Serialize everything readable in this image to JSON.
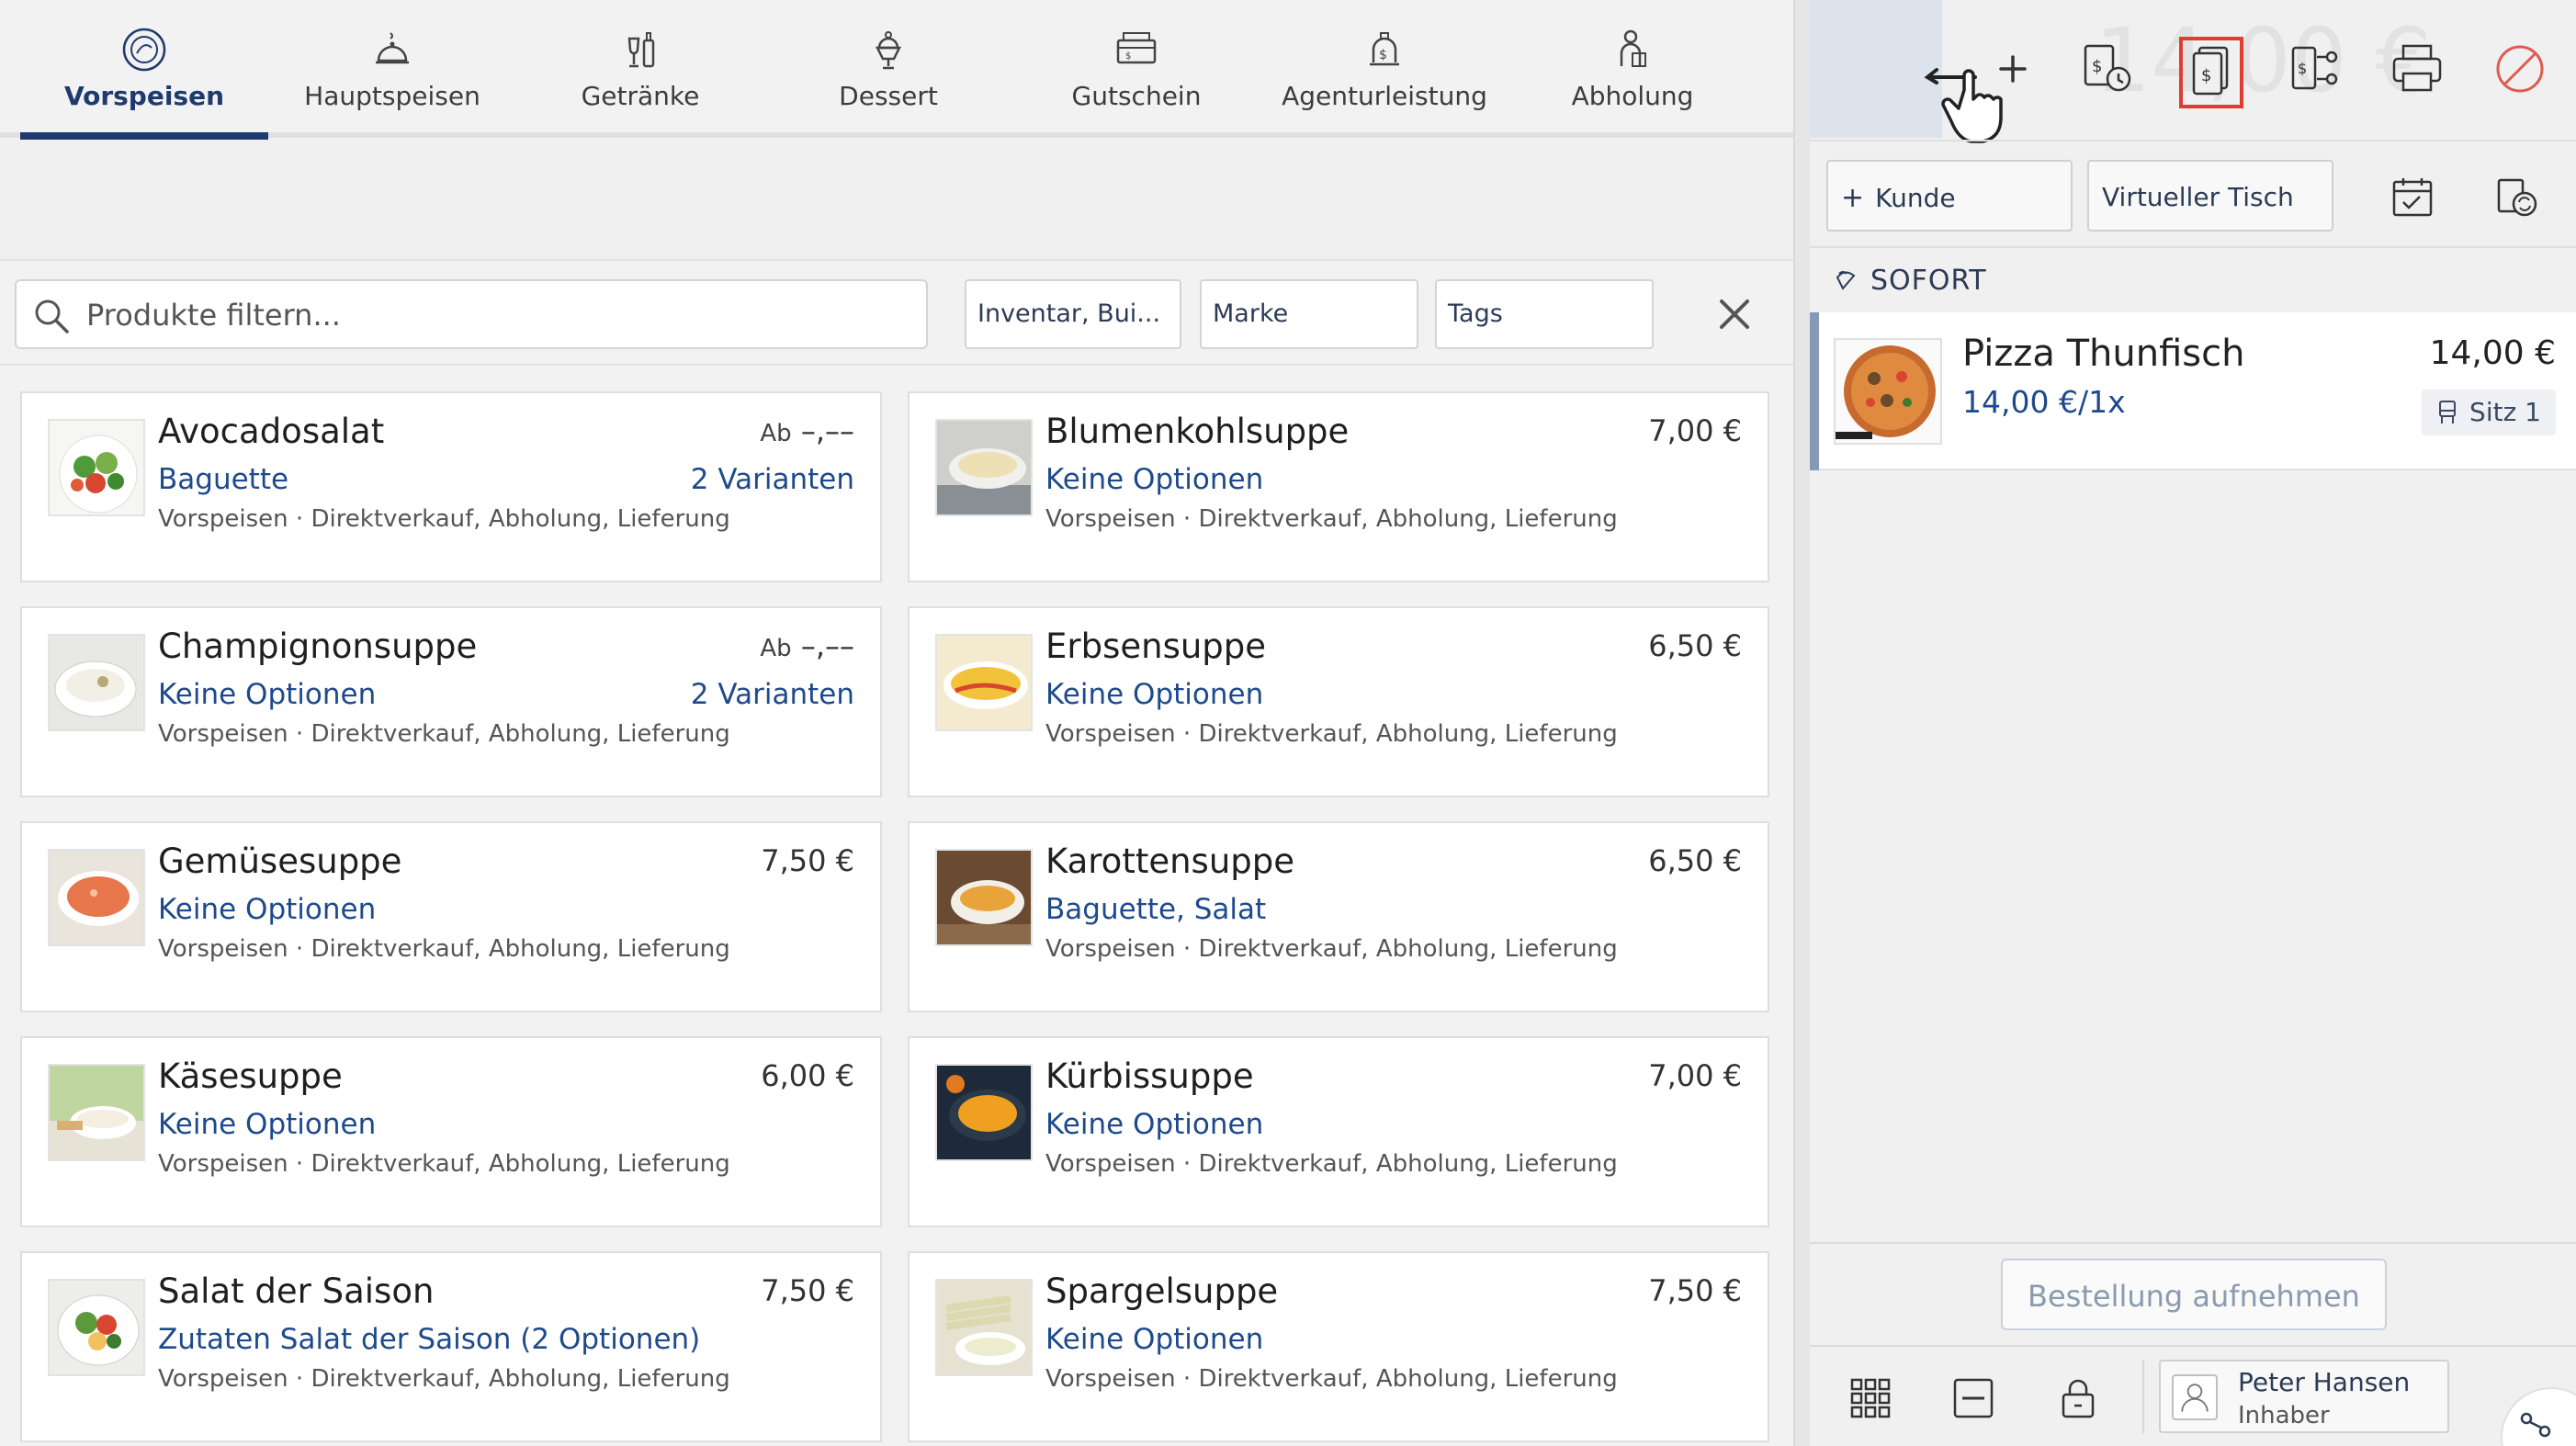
{
  "categories": [
    {
      "label": "Vorspeisen",
      "icon": "salad-icon",
      "active": true
    },
    {
      "label": "Hauptspeisen",
      "icon": "cloche-icon",
      "active": false
    },
    {
      "label": "Getränke",
      "icon": "drinks-icon",
      "active": false
    },
    {
      "label": "Dessert",
      "icon": "dessert-icon",
      "active": false
    },
    {
      "label": "Gutschein",
      "icon": "voucher-icon",
      "active": false
    },
    {
      "label": "Agenturleistung",
      "icon": "agency-service-icon",
      "active": false
    },
    {
      "label": "Abholung",
      "icon": "pickup-icon",
      "active": false
    }
  ],
  "search": {
    "placeholder": "Produkte filtern..."
  },
  "filters": {
    "inventory": "Inventar, Bui...",
    "brand": "Marke",
    "tags": "Tags"
  },
  "products": [
    {
      "name": "Avocadosalat",
      "price_prefix": "Ab",
      "price": "–,––",
      "options": "Baguette",
      "variants": "2 Varianten",
      "meta": "Vorspeisen · Direktverkauf, Abholung, Lieferung",
      "image": "salad"
    },
    {
      "name": "Blumenkohlsuppe",
      "price_prefix": "",
      "price": "7,00 €",
      "options": "Keine Optionen",
      "variants": "",
      "meta": "Vorspeisen · Direktverkauf, Abholung, Lieferung",
      "image": "cream-soup"
    },
    {
      "name": "Champignonsuppe",
      "price_prefix": "Ab",
      "price": "–,––",
      "options": "Keine Optionen",
      "variants": "2 Varianten",
      "meta": "Vorspeisen · Direktverkauf, Abholung, Lieferung",
      "image": "white-soup"
    },
    {
      "name": "Erbsensuppe",
      "price_prefix": "",
      "price": "6,50 €",
      "options": "Keine Optionen",
      "variants": "",
      "meta": "Vorspeisen · Direktverkauf, Abholung, Lieferung",
      "image": "yellow-dish"
    },
    {
      "name": "Gemüsesuppe",
      "price_prefix": "",
      "price": "7,50 €",
      "options": "Keine Optionen",
      "variants": "",
      "meta": "Vorspeisen · Direktverkauf, Abholung, Lieferung",
      "image": "orange-soup"
    },
    {
      "name": "Karottensuppe",
      "price_prefix": "",
      "price": "6,50 €",
      "options": "Baguette, Salat",
      "variants": "",
      "meta": "Vorspeisen · Direktverkauf, Abholung, Lieferung",
      "image": "bowl-soup"
    },
    {
      "name": "Käsesuppe",
      "price_prefix": "",
      "price": "6,00 €",
      "options": "Keine Optionen",
      "variants": "",
      "meta": "Vorspeisen · Direktverkauf, Abholung, Lieferung",
      "image": "cheese-soup"
    },
    {
      "name": "Kürbissuppe",
      "price_prefix": "",
      "price": "7,00 €",
      "options": "Keine Optionen",
      "variants": "",
      "meta": "Vorspeisen · Direktverkauf, Abholung, Lieferung",
      "image": "pumpkin-soup"
    },
    {
      "name": "Salat der Saison",
      "price_prefix": "",
      "price": "7,50 €",
      "options": "Zutaten Salat der Saison (2 Optionen)",
      "variants": "",
      "meta": "Vorspeisen · Direktverkauf, Abholung, Lieferung",
      "image": "season-salad"
    },
    {
      "name": "Spargelsuppe",
      "price_prefix": "",
      "price": "7,50 €",
      "options": "Keine Optionen",
      "variants": "",
      "meta": "Vorspeisen · Direktverkauf, Abholung, Lieferung",
      "image": "asparagus-soup"
    }
  ],
  "toolbar": {
    "total_ghost": "14,00 €",
    "icons": [
      "add-icon",
      "payment-history-icon",
      "receipt-icon",
      "split-bill-icon",
      "printer-icon",
      "cancel-icon"
    ],
    "highlighted_icon": "receipt-icon",
    "highlight_color": "#e03c31"
  },
  "customer": {
    "add_label": "Kunde",
    "table_label": "Virtueller Tisch"
  },
  "order": {
    "section_label": "SOFORT",
    "items": [
      {
        "name": "Pizza Thunfisch",
        "unit_price": "14,00 €/1x",
        "total": "14,00 €",
        "seat": "Sitz 1"
      }
    ],
    "take_order_label": "Bestellung aufnehmen"
  },
  "user": {
    "name": "Peter Hansen",
    "role": "Inhaber"
  },
  "colors": {
    "accent": "#1e3a6e",
    "link": "#1e4a8c",
    "highlight": "#e03c31"
  }
}
